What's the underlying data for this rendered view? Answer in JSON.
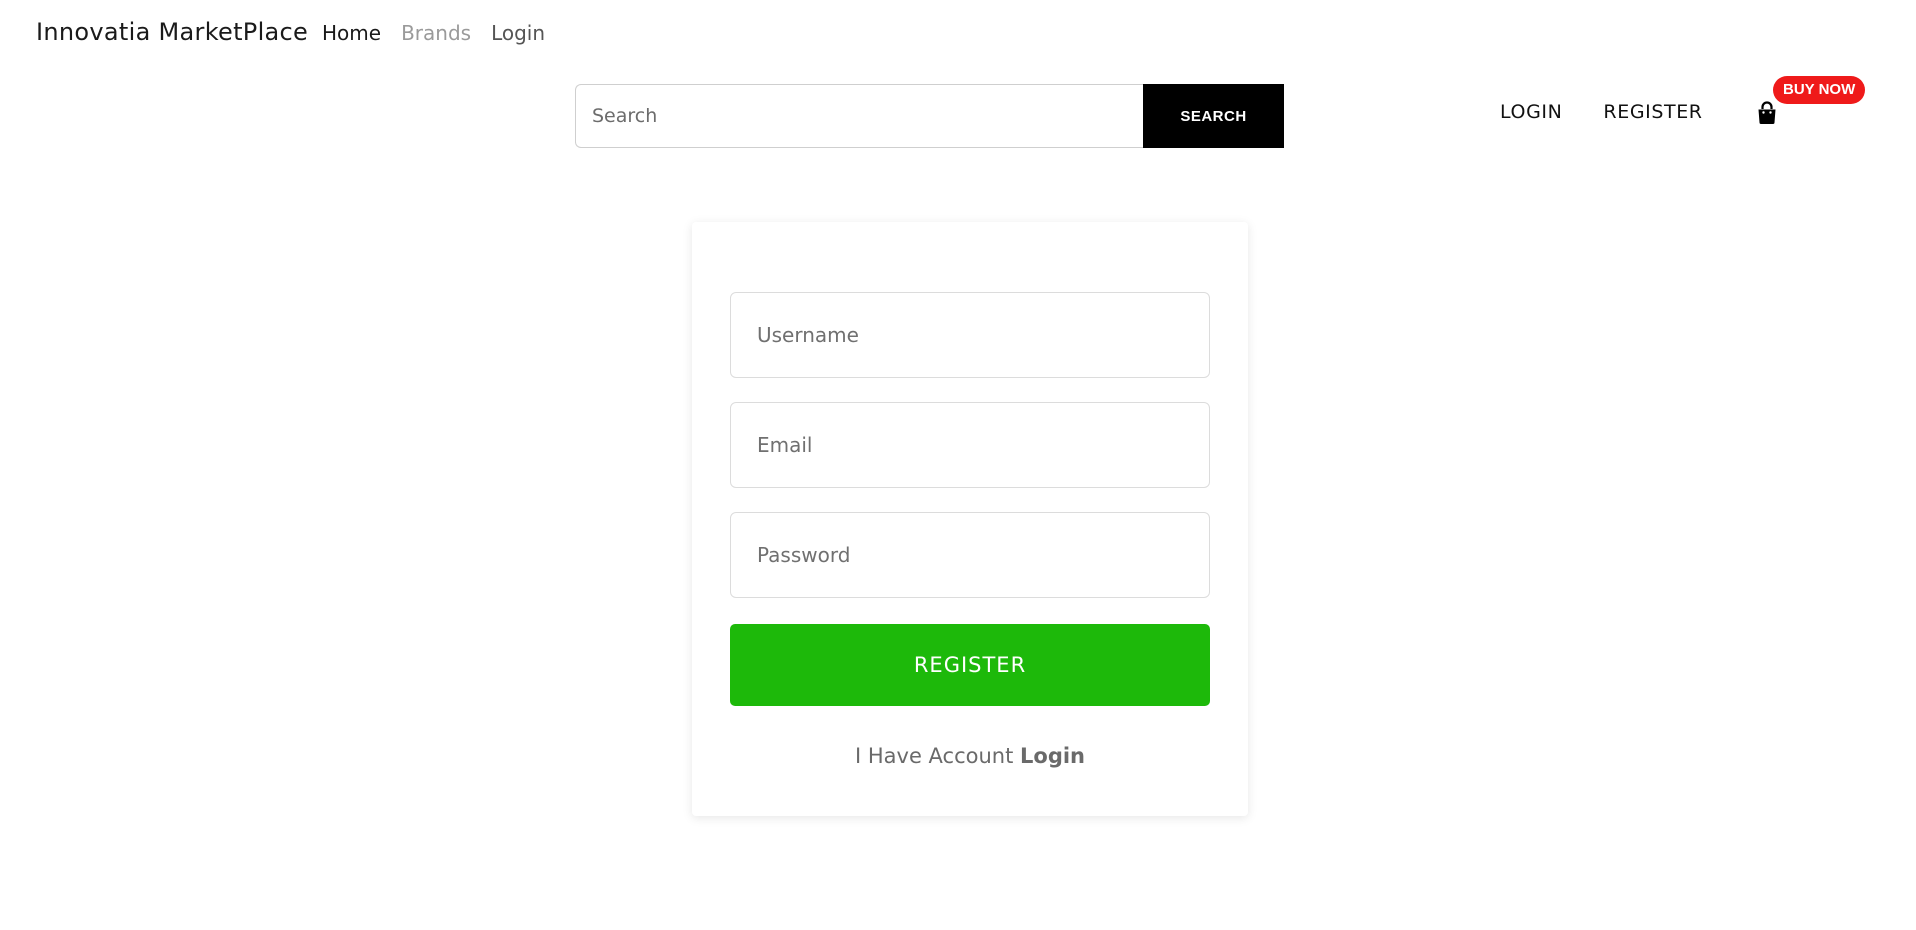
{
  "nav": {
    "brand": "Innovatia MarketPlace",
    "links": [
      "Home",
      "Brands",
      "Login"
    ]
  },
  "search": {
    "placeholder": "Search",
    "button_label": "SEARCH"
  },
  "account_nav": {
    "login": "LOGIN",
    "register": "REGISTER",
    "cart_icon": "shopping-bag-icon",
    "badge": "BUY NOW"
  },
  "form": {
    "username_placeholder": "Username",
    "email_placeholder": "Email",
    "password_placeholder": "Password",
    "submit_label": "REGISTER",
    "have_account_text": "I Have Account",
    "login_link": "Login"
  },
  "colors": {
    "accent_green": "#1db90a",
    "badge_red": "#ef1a1a",
    "search_button": "#000000"
  }
}
